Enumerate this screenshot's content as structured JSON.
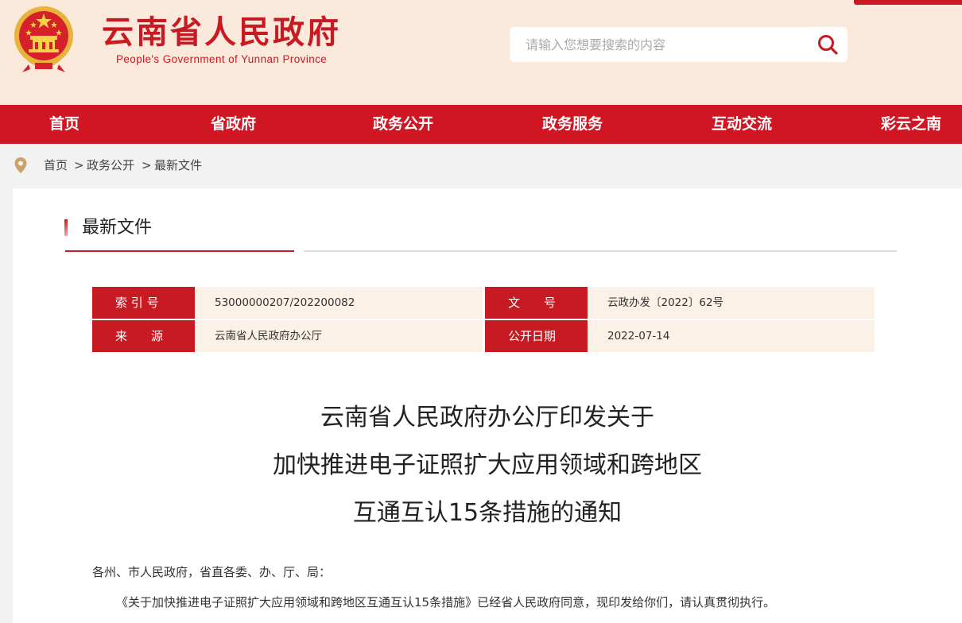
{
  "header": {
    "site_title": "云南省人民政府",
    "site_subtitle": "People's Government of Yunnan Province",
    "emblem_icon": "national-emblem-icon",
    "search": {
      "placeholder": "请输入您想要搜索的内容",
      "icon": "search-icon"
    }
  },
  "nav": {
    "items": [
      {
        "label": "首页"
      },
      {
        "label": "省政府"
      },
      {
        "label": "政务公开"
      },
      {
        "label": "政务服务"
      },
      {
        "label": "互动交流"
      },
      {
        "label": "彩云之南"
      }
    ]
  },
  "breadcrumb": {
    "icon": "location-pin-icon",
    "items": [
      "首页",
      "政务公开",
      "最新文件"
    ],
    "separator": ">"
  },
  "section": {
    "title": "最新文件"
  },
  "meta": {
    "index_label": "索 引 号",
    "index_value": "53000000207/202200082",
    "doc_no_label": "文　　号",
    "doc_no_value": "云政办发〔2022〕62号",
    "source_label": "来　　源",
    "source_value": "云南省人民政府办公厅",
    "date_label": "公开日期",
    "date_value": "2022-07-14"
  },
  "document": {
    "title_lines": [
      "云南省人民政府办公厅印发关于",
      "加快推进电子证照扩大应用领域和跨地区",
      "互通互认15条措施的通知"
    ],
    "salutation": "各州、市人民政府，省直各委、办、厅、局：",
    "paragraph_1": "《关于加快推进电子证照扩大应用领域和跨地区互通互认15条措施》已经省人民政府同意，现印发给你们，请认真贯彻执行。"
  },
  "colors": {
    "brand_red": "#c81a23",
    "nav_red": "#d01623",
    "header_bg": "#fbe9dc",
    "meta_bg": "#fbf1e6"
  }
}
